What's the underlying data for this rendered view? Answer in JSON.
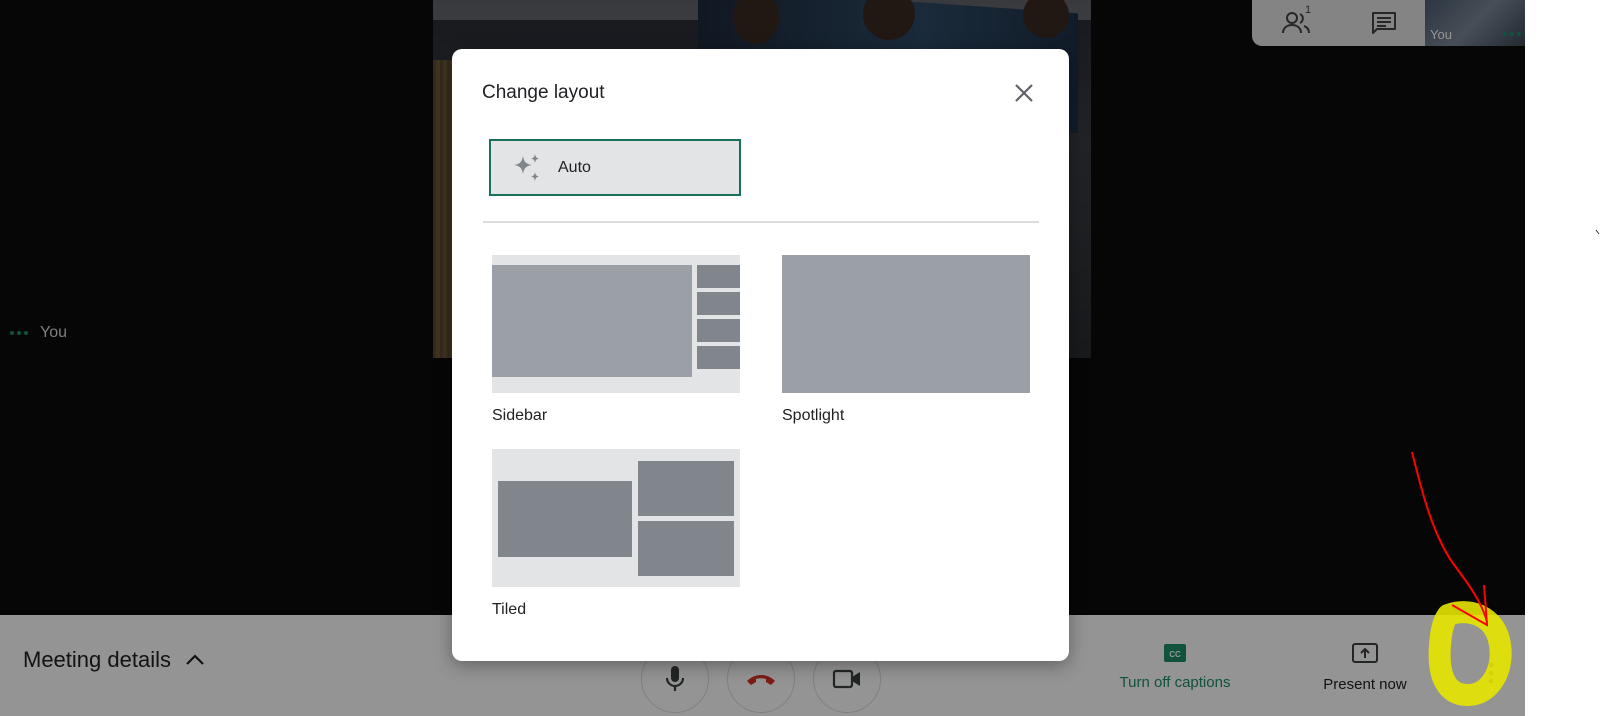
{
  "stage": {
    "self_label": "You",
    "top_tools": {
      "people_icon": "people-icon",
      "people_count": "1",
      "chat_icon": "chat-icon",
      "self_thumb_label": "You"
    }
  },
  "bottom_bar": {
    "meeting_details_label": "Meeting details",
    "captions_label": "Turn off captions",
    "present_label": "Present now"
  },
  "dialog": {
    "title": "Change layout",
    "auto_label": "Auto",
    "options": [
      {
        "label": "Sidebar"
      },
      {
        "label": "Spotlight"
      },
      {
        "label": "Tiled"
      }
    ]
  },
  "colors": {
    "accent": "#1e8e6a",
    "selected_border": "#1b6e5a",
    "thumb_bg": "#e3e4e6",
    "thumb_tile_light": "#9aa0a6",
    "thumb_tile_dark": "#80868b",
    "annotation_red": "#ff0000",
    "annotation_yellow": "#e6e600"
  }
}
